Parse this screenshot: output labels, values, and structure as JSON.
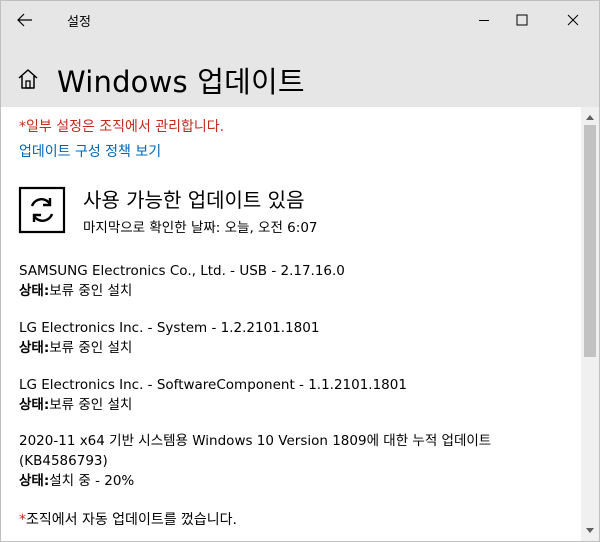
{
  "window": {
    "title": "설정"
  },
  "header": {
    "title": "Windows 업데이트"
  },
  "notice": {
    "org_managed": "*일부 설정은 조직에서 관리합니다.",
    "policy_link": "업데이트 구성 정책 보기"
  },
  "status": {
    "title": "사용 가능한 업데이트 있음",
    "last_checked": "마지막으로 확인한 날짜: 오늘, 오전 6:07"
  },
  "updates": [
    {
      "name": "SAMSUNG Electronics Co., Ltd.  - USB - 2.17.16.0",
      "state_label": "상태:",
      "state_value": "보류 중인 설치"
    },
    {
      "name": "LG Electronics Inc. - System - 1.2.2101.1801",
      "state_label": "상태:",
      "state_value": "보류 중인 설치"
    },
    {
      "name": "LG Electronics Inc. - SoftwareComponent - 1.1.2101.1801",
      "state_label": "상태:",
      "state_value": "보류 중인 설치"
    },
    {
      "name": "2020-11 x64 기반 시스템용 Windows 10 Version 1809에 대한 누적 업데이트 (KB4586793)",
      "state_label": "상태:",
      "state_value": "설치 중 - 20%"
    }
  ],
  "footer_note": {
    "star": "*",
    "text": "조직에서 자동 업데이트를 껐습니다."
  },
  "icons": {
    "back": "back-arrow-icon",
    "minimize": "minimize-icon",
    "maximize": "maximize-icon",
    "close": "close-icon",
    "home": "home-icon",
    "sync": "sync-icon"
  },
  "colors": {
    "warning": "#c42b1c",
    "link": "#0067b8",
    "chrome": "#e6e6e6"
  }
}
